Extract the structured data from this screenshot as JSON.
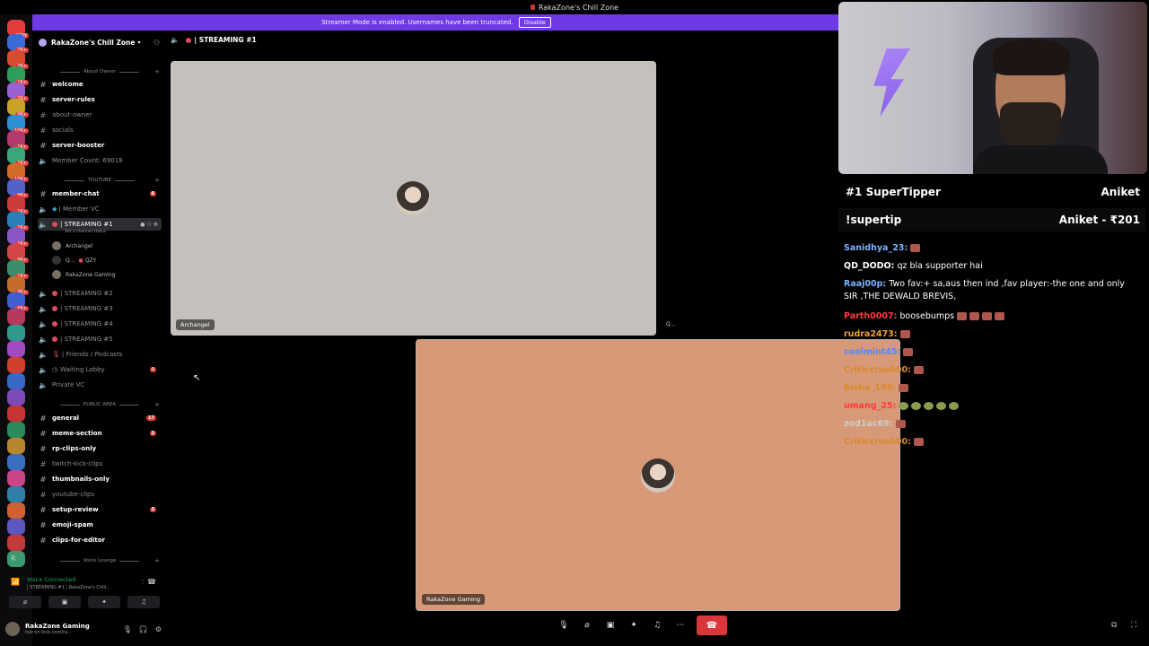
{
  "window": {
    "title": "RakaZone's Chill Zone"
  },
  "banner": {
    "text": "Streamer Mode is enabled. Usernames have been truncated.",
    "disable": "Disable"
  },
  "rail": {
    "badges": [
      "NEW",
      "2K+",
      "3K+",
      "1K+",
      "2K+",
      "9K+",
      "10K+",
      "1K+",
      "1K+",
      "10K+",
      "9K+",
      "1K+",
      "1K+",
      "1K+",
      "9K+",
      "1K+",
      "9K+",
      "6K+"
    ],
    "bottom_letter": "R"
  },
  "server": {
    "name": "RakaZone's Chill Zone"
  },
  "categories": {
    "about_owner": "About Owner",
    "youtube": "YOUTUBE",
    "public_area": "PUBLIC AREA",
    "voice_lounge": "Voice Lounge"
  },
  "channels": {
    "welcome": "welcome",
    "server_rules": "server-rules",
    "about_owner": "about-owner",
    "socials": "socials",
    "server_booster": "server-booster",
    "member_count": "Member Count: 69018",
    "member_chat": "member-chat",
    "member_chat_count": "6",
    "member_vc": "| Member VC",
    "streaming1": "| STREAMING #1",
    "streaming1_status": "Set a channel status",
    "streaming2": "| STREAMING #2",
    "streaming3": "| STREAMING #3",
    "streaming4": "| STREAMING #4",
    "streaming5": "| STREAMING #5",
    "friends_podcasts": "| Friends / Podcasts",
    "waiting_lobby": "Waiting Lobby",
    "waiting_count": "6",
    "private_vc": "Private VC",
    "general": "general",
    "general_count": "17",
    "meme_section": "meme-section",
    "meme_count": "2",
    "rp_clips_only": "rp-clips-only",
    "twitch_kick_clips": "twitch-kick-clips",
    "thumbnails_only": "thumbnails-only",
    "youtube_clips": "youtube-clips",
    "setup_review": "setup-review",
    "setup_count": "3",
    "emoji_spam": "emoji-spam",
    "clips_for_editor": "clips-for-editor"
  },
  "voice_users": [
    "Archangel",
    "Q...",
    "QZY",
    "RakaZone Gaming"
  ],
  "voice_panel": {
    "status": "Voice Connected",
    "sub": "| STREAMING #1 / RakaZone's Chill..."
  },
  "userbar": {
    "name": "RakaZone Gaming",
    "status": "live on kick.com/ra..."
  },
  "main": {
    "header": "| STREAMING #1",
    "tile1_label": "Archangel",
    "tile2_label": "RakaZone Gaming",
    "side_label": "Q..."
  },
  "overlay": {
    "supertipper_label": "#1 SuperTipper",
    "supertipper_name": "Aniket",
    "supertip_cmd": "!supertip",
    "supertip_value": "Aniket - ₹201"
  },
  "chat": [
    {
      "user": "Sanidhya_23:",
      "text": "",
      "color": "#7fb2ff"
    },
    {
      "user": "QD_DODO:",
      "text": "qz bla supporter hai",
      "color": "#ffffff"
    },
    {
      "user": "Raaj00p:",
      "text": "Two fav:+ sa,aus then ind ,fav player:-the one and only SIR ,THE DEWALD BREVIS,",
      "color": "#7fb2ff"
    },
    {
      "user": "Parth0007:",
      "text": "boosebumps",
      "color": "#ff3b3b"
    },
    {
      "user": "rudra2473:",
      "text": "",
      "color": "#f0a030"
    },
    {
      "user": "coolmint45:",
      "text": "",
      "color": "#4d8cff"
    },
    {
      "user": "Criticcrush00:",
      "text": "",
      "color": "#d98a2b"
    },
    {
      "user": "Rishu_199:",
      "text": "",
      "color": "#d98a2b"
    },
    {
      "user": "umang_25:",
      "text": "",
      "color": "#ff3b3b"
    },
    {
      "user": "zod1ac69:",
      "text": "",
      "color": "#cccccc"
    },
    {
      "user": "Criticcrush00:",
      "text": "",
      "color": "#d98a2b"
    }
  ]
}
